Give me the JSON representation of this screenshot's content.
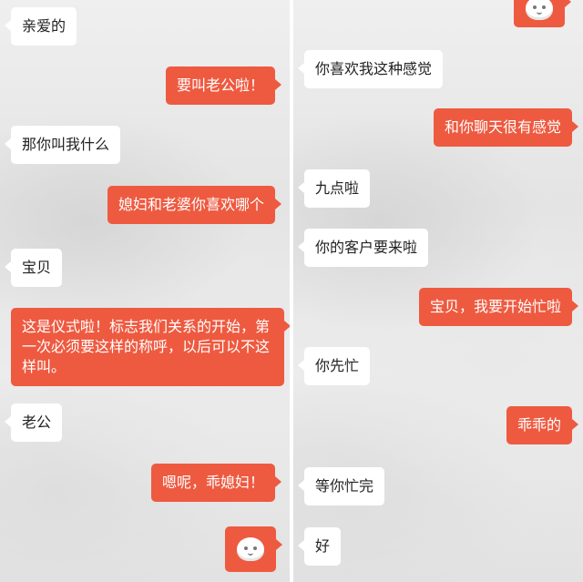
{
  "left_panel": {
    "messages": [
      {
        "side": "in",
        "text": "亲爱的"
      },
      {
        "side": "out",
        "text": "要叫老公啦！"
      },
      {
        "side": "in",
        "text": "那你叫我什么"
      },
      {
        "side": "out",
        "text": "媳妇和老婆你喜欢哪个"
      },
      {
        "side": "in",
        "text": "宝贝"
      },
      {
        "side": "out",
        "text": "这是仪式啦！标志我们关系的开始，第一次必须要这样的称呼，以后可以不这样叫。"
      },
      {
        "side": "in",
        "text": "老公"
      },
      {
        "side": "out",
        "text": "嗯呢，乖媳妇！"
      },
      {
        "side": "out",
        "sticker": "smiling-face-sticker-icon"
      }
    ]
  },
  "right_panel": {
    "messages": [
      {
        "side": "out",
        "sticker": "smiling-face-sticker-icon"
      },
      {
        "side": "in",
        "text": "你喜欢我这种感觉"
      },
      {
        "side": "out",
        "text": "和你聊天很有感觉"
      },
      {
        "side": "in",
        "text": "九点啦"
      },
      {
        "side": "in",
        "text": "你的客户要来啦"
      },
      {
        "side": "out",
        "text": "宝贝，我要开始忙啦"
      },
      {
        "side": "in",
        "text": "你先忙"
      },
      {
        "side": "out",
        "text": "乖乖的"
      },
      {
        "side": "in",
        "text": "等你忙完"
      },
      {
        "side": "in",
        "text": "好"
      }
    ]
  },
  "colors": {
    "outgoing_bubble": "#ee5a40",
    "incoming_bubble": "#ffffff",
    "outgoing_text": "#ffffff",
    "incoming_text": "#222222"
  }
}
